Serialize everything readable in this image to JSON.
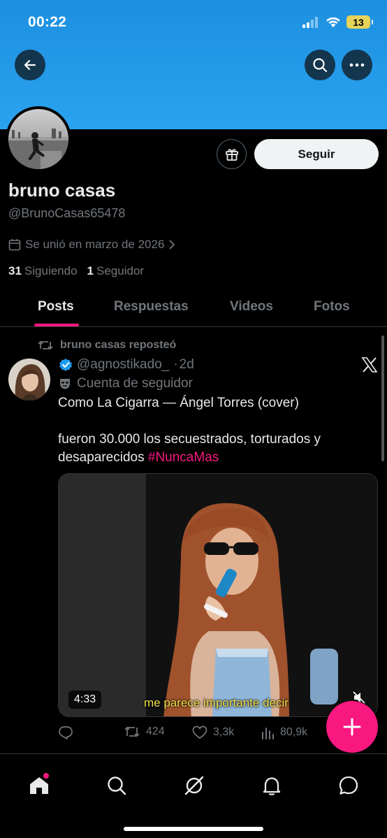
{
  "status_bar": {
    "time": "00:22",
    "battery": "13"
  },
  "profile": {
    "display_name": "bruno casas",
    "handle": "@BrunoCasas65478",
    "joined": "Se unió en marzo de 2026",
    "following_count": "31",
    "following_label": "Siguiendo",
    "followers_count": "1",
    "followers_label": "Seguidor",
    "follow_label": "Seguir"
  },
  "tabs": [
    {
      "label": "Posts",
      "active": true
    },
    {
      "label": "Respuestas",
      "active": false
    },
    {
      "label": "Videos",
      "active": false
    },
    {
      "label": "Fotos",
      "active": false
    }
  ],
  "post": {
    "repost_text": "bruno casas reposteó",
    "author_handle": "@agnostikado_",
    "time_sep": "·",
    "time": "2d",
    "label": "Cuenta de seguidor",
    "text_line1": "Como La Cigarra — Ángel Torres (cover)",
    "text_line2": "fueron 30.000 los secuestrados, torturados y desaparecidos",
    "hashtag": "#NuncaMas",
    "video_duration": "4:33",
    "video_caption": "me parece importante decir",
    "retweets": "424",
    "likes": "3,3k",
    "views": "80,9k"
  },
  "colors": {
    "accent": "#f91880",
    "banner": "#1d8fe0",
    "verified": "#1d9bf0"
  },
  "icons": [
    "back-arrow-icon",
    "search-icon",
    "more-icon",
    "gift-icon",
    "calendar-icon",
    "chevron-right-icon",
    "repost-icon",
    "verified-badge-icon",
    "mask-icon",
    "x-logo-icon",
    "reply-icon",
    "like-icon",
    "views-icon",
    "plus-icon",
    "home-icon",
    "grok-icon",
    "notifications-icon",
    "messages-icon"
  ]
}
